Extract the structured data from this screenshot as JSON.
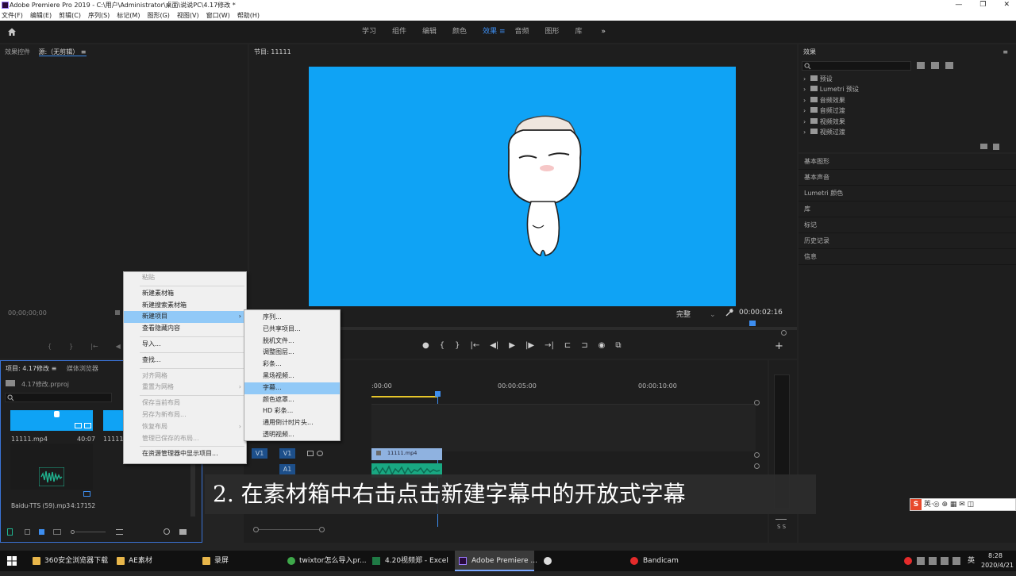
{
  "window": {
    "title": "Adobe Premiere Pro 2019 - C:\\用户\\Administrator\\桌面\\说说PC\\4.17修改 *",
    "controls": [
      "—",
      "❐",
      "✕"
    ]
  },
  "menu": [
    "文件(F)",
    "编辑(E)",
    "剪辑(C)",
    "序列(S)",
    "标记(M)",
    "图形(G)",
    "视图(V)",
    "窗口(W)",
    "帮助(H)"
  ],
  "workspaces": {
    "tabs": [
      "学习",
      "组件",
      "编辑",
      "颜色",
      "效果",
      "音频",
      "图形",
      "库"
    ],
    "active": "效果",
    "more": "»",
    "menu_icon": "≡"
  },
  "source": {
    "tab1": "效果控件",
    "tab2": "源:（无剪辑）",
    "menu": "≡",
    "timecode": "00;00;00;00",
    "transport": [
      "{",
      "}",
      "|←",
      "◀"
    ]
  },
  "program": {
    "title": "节目: 11111",
    "menu": "≡",
    "bg_color": "#0fa3f5",
    "zoom": "完整",
    "timecode": "00:00:02:16",
    "dropdown": "⌄",
    "plus": "+",
    "transport": [
      "●",
      "{",
      "}",
      "|←",
      "◀|",
      "▶",
      "|▶",
      "→|",
      "⊏",
      "⊐",
      "◉",
      "⧉"
    ]
  },
  "effects": {
    "title": "效果",
    "menu": "≡",
    "tree": [
      "预设",
      "Lumetri 预设",
      "音频效果",
      "音频过渡",
      "视频效果",
      "视频过渡"
    ],
    "sections": [
      "基本图形",
      "基本声音",
      "Lumetri 颜色",
      "库",
      "标记",
      "历史记录",
      "信息"
    ]
  },
  "project": {
    "tab1": "项目: 4.17修改",
    "tab2": "媒体浏览器",
    "menu": "≡",
    "more": "»",
    "file": "4.17修改.prproj",
    "items": [
      {
        "name": "11111.mp4",
        "duration": "40:07"
      },
      {
        "name": "11111",
        "duration": ""
      },
      {
        "name": "Baidu-TTS (59).mp3",
        "duration": "4:17152"
      }
    ]
  },
  "timeline": {
    "time_start": ":00:00",
    "time_mid": "00:00:05:00",
    "time_end": "00:00:10:00",
    "v1_label": "V1",
    "a1_label": "A1",
    "clip_name": "11111.mp4",
    "meter_label": "S S"
  },
  "context_menu": {
    "items": [
      {
        "label": "粘贴",
        "disabled": true
      },
      {
        "sep": true
      },
      {
        "label": "新建素材箱"
      },
      {
        "label": "新建搜索素材箱"
      },
      {
        "label": "新建项目",
        "submenu": true,
        "highlight": true
      },
      {
        "label": "查看隐藏内容"
      },
      {
        "sep": true
      },
      {
        "label": "导入..."
      },
      {
        "sep": true
      },
      {
        "label": "查找..."
      },
      {
        "sep": true
      },
      {
        "label": "对齐网格",
        "disabled": true
      },
      {
        "label": "重置为网格",
        "disabled": true,
        "submenu": true
      },
      {
        "sep": true
      },
      {
        "label": "保存当前布局",
        "disabled": true
      },
      {
        "label": "另存为新布局...",
        "disabled": true
      },
      {
        "label": "恢复布局",
        "disabled": true,
        "submenu": true
      },
      {
        "label": "管理已保存的布局...",
        "disabled": true
      },
      {
        "sep": true
      },
      {
        "label": "在资源管理器中显示项目..."
      }
    ],
    "submenu_arrow": "›"
  },
  "submenu": {
    "items": [
      "序列...",
      "已共享项目...",
      "脱机文件...",
      "调整图层...",
      "彩条...",
      "黑场视频...",
      "字幕...",
      "颜色遮罩...",
      "HD 彩条...",
      "通用倒计时片头...",
      "透明视频..."
    ],
    "highlight_index": 6
  },
  "caption": "2. 在素材箱中右击点击新建字幕中的开放式字幕",
  "tray": {
    "ime": "英",
    "ime_icons": "英·◎ ⊕ ▦ ✉ ◫",
    "time": "8:28",
    "date": "2020/4/21",
    "lang": "英"
  },
  "taskbar": {
    "items": [
      "360安全浏览器下载",
      "AE素材",
      "录屏",
      "twixtor怎么导入pr...",
      "4.20视频郑 - Excel",
      "Adobe Premiere ...",
      "",
      "Bandicam"
    ]
  }
}
